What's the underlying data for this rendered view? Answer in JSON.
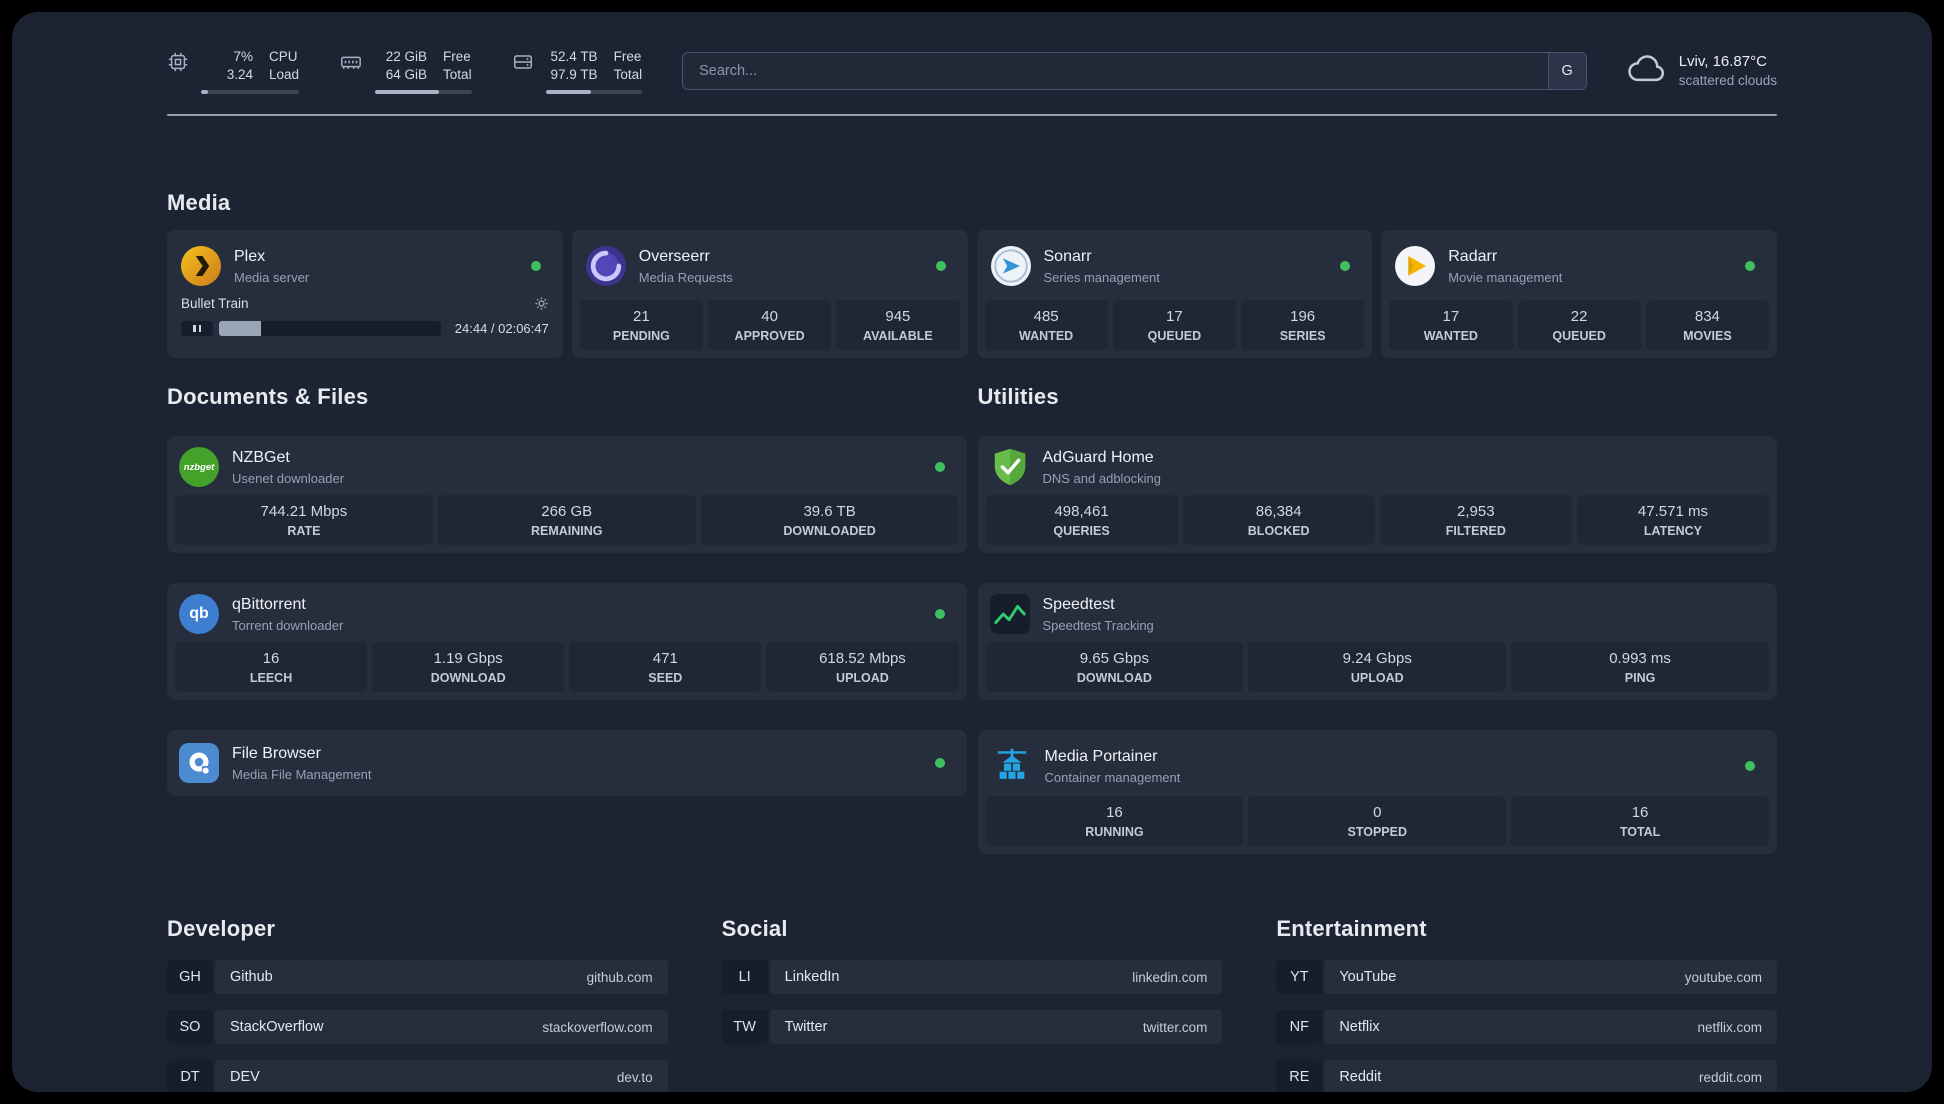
{
  "topbar": {
    "metrics": [
      {
        "icon": "cpu-icon",
        "values": [
          "7%",
          "3.24"
        ],
        "labels": [
          "CPU",
          "Load"
        ],
        "progress_pct": 7
      },
      {
        "icon": "ram-icon",
        "values": [
          "22 GiB",
          "64 GiB"
        ],
        "labels": [
          "Free",
          "Total"
        ],
        "progress_pct": 66
      },
      {
        "icon": "disk-icon",
        "values": [
          "52.4 TB",
          "97.9 TB"
        ],
        "labels": [
          "Free",
          "Total"
        ],
        "progress_pct": 47
      }
    ],
    "search": {
      "placeholder": "Search...",
      "engine_label": "G"
    },
    "weather": {
      "icon": "cloud-icon",
      "location": "Lviv, 16.87°C",
      "condition": "scattered clouds"
    }
  },
  "media": {
    "title": "Media",
    "plex": {
      "name": "Plex",
      "desc": "Media server",
      "icon": "plex-icon",
      "online": true,
      "now_playing": "Bullet Train",
      "time": "24:44 / 02:06:47",
      "progress_pct": 19
    },
    "apps": [
      {
        "name": "Overseerr",
        "desc": "Media Requests",
        "icon": "overseerr-icon",
        "online": true,
        "stats": [
          {
            "value": "21",
            "label": "PENDING"
          },
          {
            "value": "40",
            "label": "APPROVED"
          },
          {
            "value": "945",
            "label": "AVAILABLE"
          }
        ]
      },
      {
        "name": "Sonarr",
        "desc": "Series management",
        "icon": "sonarr-icon",
        "online": true,
        "stats": [
          {
            "value": "485",
            "label": "WANTED"
          },
          {
            "value": "17",
            "label": "QUEUED"
          },
          {
            "value": "196",
            "label": "SERIES"
          }
        ]
      },
      {
        "name": "Radarr",
        "desc": "Movie management",
        "icon": "radarr-icon",
        "online": true,
        "stats": [
          {
            "value": "17",
            "label": "WANTED"
          },
          {
            "value": "22",
            "label": "QUEUED"
          },
          {
            "value": "834",
            "label": "MOVIES"
          }
        ]
      }
    ]
  },
  "documents": {
    "title": "Documents & Files",
    "apps": [
      {
        "name": "NZBGet",
        "desc": "Usenet downloader",
        "icon": "nzbget-icon",
        "icon_text": "nzbget",
        "online": true,
        "stats": [
          {
            "value": "744.21 Mbps",
            "label": "RATE"
          },
          {
            "value": "266 GB",
            "label": "REMAINING"
          },
          {
            "value": "39.6 TB",
            "label": "DOWNLOADED"
          }
        ]
      },
      {
        "name": "qBittorrent",
        "desc": "Torrent downloader",
        "icon": "qbittorrent-icon",
        "icon_text": "qb",
        "online": true,
        "stats": [
          {
            "value": "16",
            "label": "LEECH"
          },
          {
            "value": "1.19 Gbps",
            "label": "DOWNLOAD"
          },
          {
            "value": "471",
            "label": "SEED"
          },
          {
            "value": "618.52 Mbps",
            "label": "UPLOAD"
          }
        ]
      },
      {
        "name": "File Browser",
        "desc": "Media File Management",
        "icon": "filebrowser-icon",
        "online": true,
        "stats": []
      }
    ]
  },
  "utilities": {
    "title": "Utilities",
    "apps": [
      {
        "name": "AdGuard Home",
        "desc": "DNS and adblocking",
        "icon": "adguard-icon",
        "online": false,
        "stats": [
          {
            "value": "498,461",
            "label": "QUERIES"
          },
          {
            "value": "86,384",
            "label": "BLOCKED"
          },
          {
            "value": "2,953",
            "label": "FILTERED"
          },
          {
            "value": "47.571 ms",
            "label": "LATENCY"
          }
        ]
      },
      {
        "name": "Speedtest",
        "desc": "Speedtest Tracking",
        "icon": "speedtest-icon",
        "online": false,
        "stats": [
          {
            "value": "9.65 Gbps",
            "label": "DOWNLOAD"
          },
          {
            "value": "9.24 Gbps",
            "label": "UPLOAD"
          },
          {
            "value": "0.993 ms",
            "label": "PING"
          }
        ]
      },
      {
        "name": "Media Portainer",
        "desc": "Container management",
        "icon": "portainer-icon",
        "online": true,
        "stats": [
          {
            "value": "16",
            "label": "RUNNING"
          },
          {
            "value": "0",
            "label": "STOPPED"
          },
          {
            "value": "16",
            "label": "TOTAL"
          }
        ]
      }
    ]
  },
  "bookmarks": [
    {
      "title": "Developer",
      "links": [
        {
          "abbr": "GH",
          "name": "Github",
          "url": "github.com"
        },
        {
          "abbr": "SO",
          "name": "StackOverflow",
          "url": "stackoverflow.com"
        },
        {
          "abbr": "DT",
          "name": "DEV",
          "url": "dev.to"
        }
      ]
    },
    {
      "title": "Social",
      "links": [
        {
          "abbr": "LI",
          "name": "LinkedIn",
          "url": "linkedin.com"
        },
        {
          "abbr": "TW",
          "name": "Twitter",
          "url": "twitter.com"
        }
      ]
    },
    {
      "title": "Entertainment",
      "links": [
        {
          "abbr": "YT",
          "name": "YouTube",
          "url": "youtube.com"
        },
        {
          "abbr": "NF",
          "name": "Netflix",
          "url": "netflix.com"
        },
        {
          "abbr": "RE",
          "name": "Reddit",
          "url": "reddit.com"
        }
      ]
    }
  ],
  "colors": {
    "background": "#1c2434",
    "card": "#262e3e",
    "tile": "#1f2736",
    "status_online": "#3fc060",
    "accent_green": "#2ecc71"
  }
}
